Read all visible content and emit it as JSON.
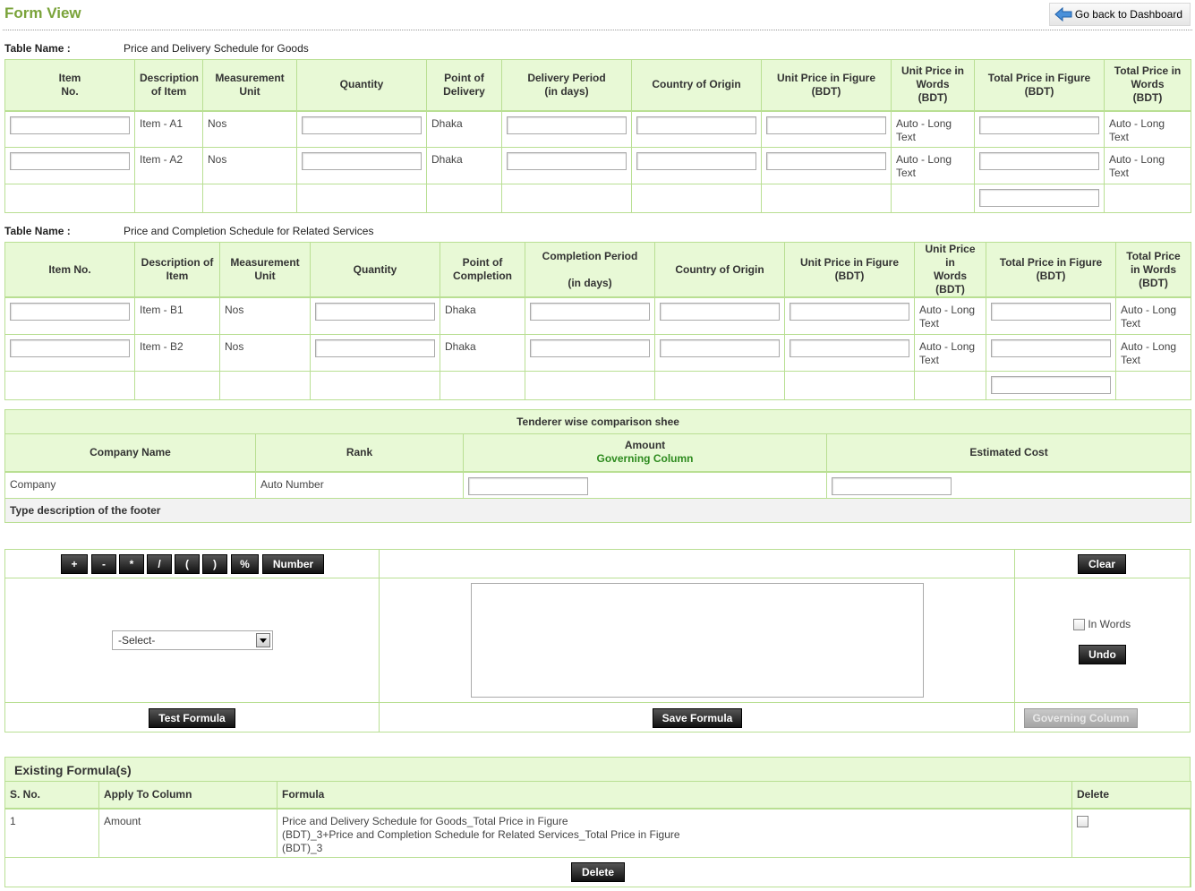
{
  "header": {
    "title": "Form View",
    "back_link": "Go back to Dashboard"
  },
  "goods_table": {
    "label": "Table Name :",
    "name": "Price and Delivery Schedule for Goods",
    "columns": [
      "Item No.",
      "Description of Item",
      "Measurement Unit",
      "Quantity",
      "Point of Delivery",
      "Delivery Period (in days)",
      "Country of Origin",
      "Unit Price in Figure (BDT)",
      "Unit Price in Words (BDT)",
      "Total Price in Figure (BDT)",
      "Total Price in Words (BDT)"
    ],
    "col_lines": {
      "item_no": [
        "Item",
        "No."
      ],
      "desc": [
        "Description",
        "of Item"
      ],
      "unit": [
        "Measurement",
        "Unit"
      ],
      "qty": [
        "Quantity"
      ],
      "point": [
        "Point of",
        "Delivery"
      ],
      "period": [
        "Delivery Period",
        "(in days)"
      ],
      "country": [
        "Country of Origin"
      ],
      "upf": [
        "Unit Price in Figure",
        "(BDT)"
      ],
      "upw": [
        "Unit Price in",
        "Words",
        "(BDT)"
      ],
      "tpf": [
        "Total Price in Figure",
        "(BDT)"
      ],
      "tpw": [
        "Total Price in",
        "Words",
        "(BDT)"
      ]
    },
    "rows": [
      {
        "desc": "Item - A1",
        "unit": "Nos",
        "point": "Dhaka",
        "upw": [
          "Auto - Long",
          "Text"
        ],
        "tpw": [
          "Auto - Long",
          "Text"
        ]
      },
      {
        "desc": "Item - A2",
        "unit": "Nos",
        "point": "Dhaka",
        "upw": [
          "Auto - Long",
          "Text"
        ],
        "tpw": [
          "Auto - Long",
          "Text"
        ]
      }
    ]
  },
  "services_table": {
    "label": "Table Name :",
    "name": "Price and Completion Schedule for Related Services",
    "col_lines": {
      "item_no": [
        "Item No."
      ],
      "desc": [
        "Description of",
        "Item"
      ],
      "unit": [
        "Measurement",
        "Unit"
      ],
      "qty": [
        "Quantity"
      ],
      "point": [
        "Point of",
        "Completion"
      ],
      "period": [
        "Completion Period",
        "",
        "(in days)"
      ],
      "country": [
        "Country of Origin"
      ],
      "upf": [
        "Unit Price in Figure",
        "(BDT)"
      ],
      "upw": [
        "Unit Price in",
        "Words",
        "(BDT)"
      ],
      "tpf": [
        "Total Price in Figure",
        "(BDT)"
      ],
      "tpw": [
        "Total Price",
        "in Words",
        "(BDT)"
      ]
    },
    "rows": [
      {
        "desc": "Item - B1",
        "unit": "Nos",
        "point": "Dhaka",
        "upw": [
          "Auto - Long",
          "Text"
        ],
        "tpw": [
          "Auto - Long",
          "Text"
        ]
      },
      {
        "desc": "Item - B2",
        "unit": "Nos",
        "point": "Dhaka",
        "upw": [
          "Auto - Long",
          "Text"
        ],
        "tpw": [
          "Auto - Long",
          "Text"
        ]
      }
    ]
  },
  "comparison": {
    "title": "Tenderer wise comparison shee",
    "col_company": "Company Name",
    "col_rank": "Rank",
    "col_amount": "Amount",
    "col_amount_sub": "Governing Column",
    "col_estimated": "Estimated Cost",
    "row_company": "Company",
    "row_rank": "Auto Number",
    "footer": "Type description of the footer",
    "sub_color": "#2e8b1f"
  },
  "formula_builder": {
    "operators": [
      "+",
      "-",
      "*",
      "/",
      "(",
      ")",
      "%",
      "Number"
    ],
    "clear": "Clear",
    "select_value": "-Select-",
    "in_words": "In Words",
    "undo": "Undo",
    "test": "Test Formula",
    "save": "Save Formula",
    "governing": "Governing Column"
  },
  "existing": {
    "title": "Existing Formula(s)",
    "col_sno": "S. No.",
    "col_apply": "Apply To Column",
    "col_formula": "Formula",
    "col_delete": "Delete",
    "rows": [
      {
        "sno": "1",
        "apply": "Amount",
        "formula": [
          "Price and Delivery Schedule for Goods_Total Price in Figure",
          "(BDT)_3+Price and Completion Schedule for Related Services_Total Price in Figure",
          "(BDT)_3"
        ]
      }
    ],
    "delete_button": "Delete"
  },
  "colors": {
    "accent_green": "#7aa33a",
    "header_bg": "#e8f9d6",
    "border": "#b9df93"
  }
}
